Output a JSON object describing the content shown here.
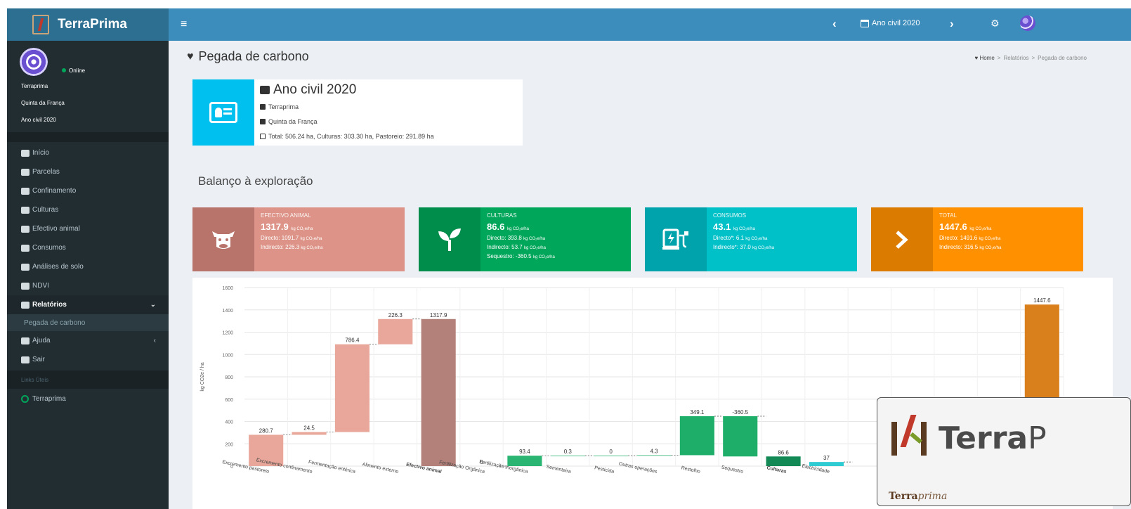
{
  "brand": {
    "name": "TerraPrima"
  },
  "navbar": {
    "menu_icon": "≡",
    "prev": "‹",
    "period": "Ano civil 2020",
    "next": "›",
    "gears": "⚙"
  },
  "sidebar": {
    "online": "Online",
    "user_lines": [
      "Terraprima",
      "Quinta da França",
      "Ano civil 2020"
    ],
    "menu": [
      {
        "label": "Início",
        "icon": "home-icon"
      },
      {
        "label": "Parcelas",
        "icon": "map-icon"
      },
      {
        "label": "Confinamento",
        "icon": "barn-icon"
      },
      {
        "label": "Culturas",
        "icon": "plant-icon"
      },
      {
        "label": "Efectivo animal",
        "icon": "cow-icon"
      },
      {
        "label": "Consumos",
        "icon": "fuel-icon"
      },
      {
        "label": "Análises de solo",
        "icon": "flask-icon"
      },
      {
        "label": "NDVI",
        "icon": "satellite-icon"
      },
      {
        "label": "Relatórios",
        "icon": "folder-icon"
      },
      {
        "label": "Pegada de carbono",
        "icon": ""
      },
      {
        "label": "Ajuda",
        "icon": "help-icon"
      },
      {
        "label": "Sair",
        "icon": "logout-icon"
      }
    ],
    "links_header": "Links Úteis",
    "links": [
      "Terraprima"
    ]
  },
  "page": {
    "title": "Pegada de carbono",
    "breadcrumb": [
      "Home",
      ">",
      "Relatórios",
      ">",
      "Pegada de carbono"
    ]
  },
  "info": {
    "title": "Ano civil 2020",
    "user": "Terraprima",
    "farm": "Quinta da França",
    "area": "Total: 506.24 ha, Culturas: 303.30 ha, Pastoreio: 291.89 ha"
  },
  "section_title": "Balanço à exploração",
  "kpis": {
    "animal": {
      "title": "Efectivo animal",
      "value": "1317.9",
      "unit": "kg CO₂e/ha",
      "line1": "Directo: 1091.7",
      "line2": "Indirecto: 226.3",
      "color": "#dd9387",
      "icon_color": "#b8736a"
    },
    "crops": {
      "title": "Culturas",
      "value": "86.6",
      "unit": "kg CO₂e/ha",
      "line1": "Directo: 393.8",
      "line2": "Indirecto: 53.7",
      "line3": "Sequestro: -360.5",
      "color": "#00a65a",
      "icon_color": "#008d4c"
    },
    "consumption": {
      "title": "Consumos",
      "value": "43.1",
      "unit": "kg CO₂e/ha",
      "line1": "Directo*: 6.1",
      "line2": "Indirecto*: 37.0",
      "color": "#00c0c8",
      "icon_color": "#00a3ab"
    },
    "total": {
      "title": "Total",
      "value": "1447.6",
      "unit": "kg CO₂e/ha",
      "line1": "Directo: 1491.6",
      "line2": "Indirecto: 316.5",
      "color": "#ff9000",
      "icon_color": "#db7c00"
    }
  },
  "chart_data": {
    "type": "bar",
    "subtype": "waterfall",
    "ylabel": "kg CO2e / ha",
    "ylim": [
      0,
      1600
    ],
    "yticks": [
      0,
      200,
      400,
      600,
      800,
      1000,
      1200,
      1400,
      1600
    ],
    "grid": true,
    "bars": [
      {
        "label": "Excremento pastoreio",
        "base": 0,
        "top": 280.7,
        "value_label": "280.7",
        "color": "#e8a79a",
        "kind": "step"
      },
      {
        "label": "Excremento confinamento",
        "base": 280.7,
        "top": 305.2,
        "value_label": "24.5",
        "color": "#e8a79a",
        "kind": "step"
      },
      {
        "label": "Fermentação entérica",
        "base": 305.2,
        "top": 1091.6,
        "value_label": "786.4",
        "color": "#e8a79a",
        "kind": "step"
      },
      {
        "label": "Alimento externo",
        "base": 1091.6,
        "top": 1317.9,
        "value_label": "226.3",
        "color": "#e8a79a",
        "kind": "step"
      },
      {
        "label": "Efectivo animal",
        "base": 0,
        "top": 1317.9,
        "value_label": "1317.9",
        "color": "#b3807a",
        "kind": "total",
        "bold": true
      },
      {
        "label": "Fertilização Orgânica",
        "base": 0,
        "top": 0,
        "value_label": "0",
        "color": "#2bb573",
        "kind": "step"
      },
      {
        "label": "Fertilização Inorgânica",
        "base": 0,
        "top": 93.4,
        "value_label": "93.4",
        "color": "#2bb573",
        "kind": "step"
      },
      {
        "label": "Sementeira",
        "base": 93.4,
        "top": 93.7,
        "value_label": "0.3",
        "color": "#2bb573",
        "kind": "step"
      },
      {
        "label": "Pesticida",
        "base": 93.7,
        "top": 93.7,
        "value_label": "0",
        "color": "#2bb573",
        "kind": "step"
      },
      {
        "label": "Outras operações",
        "base": 93.7,
        "top": 98.0,
        "value_label": "4.3",
        "color": "#2bb573",
        "kind": "step"
      },
      {
        "label": "Restolho",
        "base": 98.0,
        "top": 447.1,
        "value_label": "349.1",
        "color": "#1fae6a",
        "kind": "step"
      },
      {
        "label": "Sequestro",
        "base": 86.6,
        "top": 447.1,
        "value_label": "-360.5",
        "color": "#1fae6a",
        "kind": "step"
      },
      {
        "label": "Culturas",
        "base": 0,
        "top": 86.6,
        "value_label": "86.6",
        "color": "#138a55",
        "kind": "total",
        "bold": true
      },
      {
        "label": "Electricidade",
        "base": 0,
        "top": 37,
        "value_label": "37",
        "color": "#2ecbd2",
        "kind": "step"
      },
      {
        "label": "",
        "base": 0,
        "top": 0,
        "value_label": "",
        "color": "#2ecbd2",
        "kind": "step"
      },
      {
        "label": "",
        "base": 0,
        "top": 0,
        "value_label": "",
        "color": "#2ecbd2",
        "kind": "step"
      },
      {
        "label": "",
        "base": 0,
        "top": 0,
        "value_label": "",
        "color": "#2ecbd2",
        "kind": "step"
      },
      {
        "label": "",
        "base": 0,
        "top": 0,
        "value_label": "",
        "color": "#2ecbd2",
        "kind": "step"
      },
      {
        "label": "",
        "base": 0,
        "top": 1447.6,
        "value_label": "1447.6",
        "color": "#d9801c",
        "kind": "total"
      }
    ]
  },
  "logo": {
    "word_bold": "Terra",
    "word_light": "P",
    "small_bold": "Terra",
    "small_italic": "prima"
  }
}
